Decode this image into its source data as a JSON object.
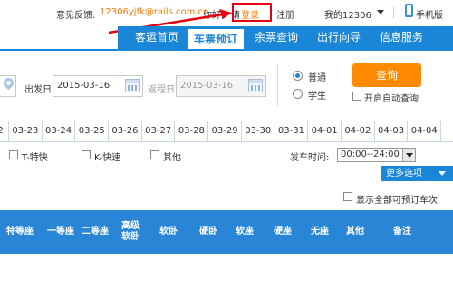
{
  "topbar": {
    "feedback_label": "意见反馈:",
    "feedback_email": "12306yjfk@rails.com.cn",
    "hello": "你好,",
    "please": "请",
    "login": "登录",
    "register": "注册",
    "my12306": "我的12306",
    "mobile": "手机版"
  },
  "nav": {
    "items": [
      {
        "label": "客运首页"
      },
      {
        "label": "车票预订"
      },
      {
        "label": "余票查询"
      },
      {
        "label": "出行向导"
      },
      {
        "label": "信息服务"
      }
    ]
  },
  "search": {
    "depart_label": "出发日",
    "depart_date": "2015-03-16",
    "return_label": "返程日",
    "return_date": "2015-03-16",
    "radio_normal": "普通",
    "radio_student": "学生",
    "query_button": "查询",
    "auto_query": "开启自动查询"
  },
  "date_strip": {
    "dates": [
      "2",
      "03-23",
      "03-24",
      "03-25",
      "03-26",
      "03-27",
      "03-28",
      "03-29",
      "03-30",
      "03-31",
      "04-01",
      "04-02",
      "04-03",
      "04-04"
    ]
  },
  "filters": {
    "t_express": "T-特快",
    "k_fast": "K-快速",
    "other": "其他",
    "depart_time_label": "发车时间:",
    "depart_time_value": "00:00--24:00",
    "more_options": "更多选项",
    "show_all": "显示全部可预订车次"
  },
  "table": {
    "headers": [
      "特等座",
      "一等座",
      "二等座",
      "高级软卧",
      "软卧",
      "硬卧",
      "软座",
      "硬座",
      "无座",
      "其他",
      "备注"
    ]
  },
  "colors": {
    "primary_blue": "#1a86d7",
    "header_blue": "#2986d6",
    "orange": "#ff8a00",
    "annotation_red": "#e60012"
  }
}
